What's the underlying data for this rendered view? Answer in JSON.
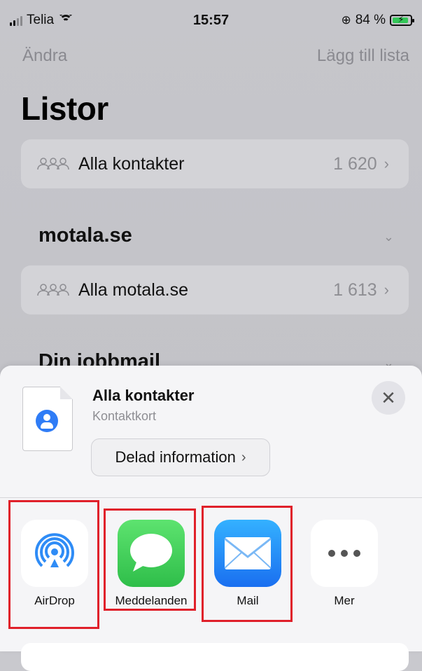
{
  "status_bar": {
    "carrier": "Telia",
    "time": "15:57",
    "battery_text": "84 %",
    "orientation_lock_icon": "lock-rotation-icon"
  },
  "nav": {
    "left": "Ändra",
    "right": "Lägg till lista"
  },
  "page_title": "Listor",
  "lists": [
    {
      "label": "Alla kontakter",
      "count": "1 620",
      "icon": "people-icon"
    }
  ],
  "sections": [
    {
      "title": "motala.se",
      "rows": [
        {
          "label": "Alla motala.se",
          "count": "1 613",
          "icon": "people-icon"
        }
      ]
    },
    {
      "title": "Din jobbmail"
    }
  ],
  "share_sheet": {
    "title": "Alla kontakter",
    "subtitle": "Kontaktkort",
    "info_button": "Delad information",
    "apps": [
      {
        "name": "AirDrop",
        "icon": "airdrop-icon",
        "highlighted": true
      },
      {
        "name": "Meddelanden",
        "icon": "messages-icon",
        "highlighted": true
      },
      {
        "name": "Mail",
        "icon": "mail-icon",
        "highlighted": true
      },
      {
        "name": "Mer",
        "icon": "more-icon",
        "highlighted": false
      }
    ]
  },
  "colors": {
    "highlight": "#e0202a",
    "messages_green": "#34c759",
    "mail_blue": "#1e8cf5",
    "airdrop_blue": "#2f8cf6"
  }
}
